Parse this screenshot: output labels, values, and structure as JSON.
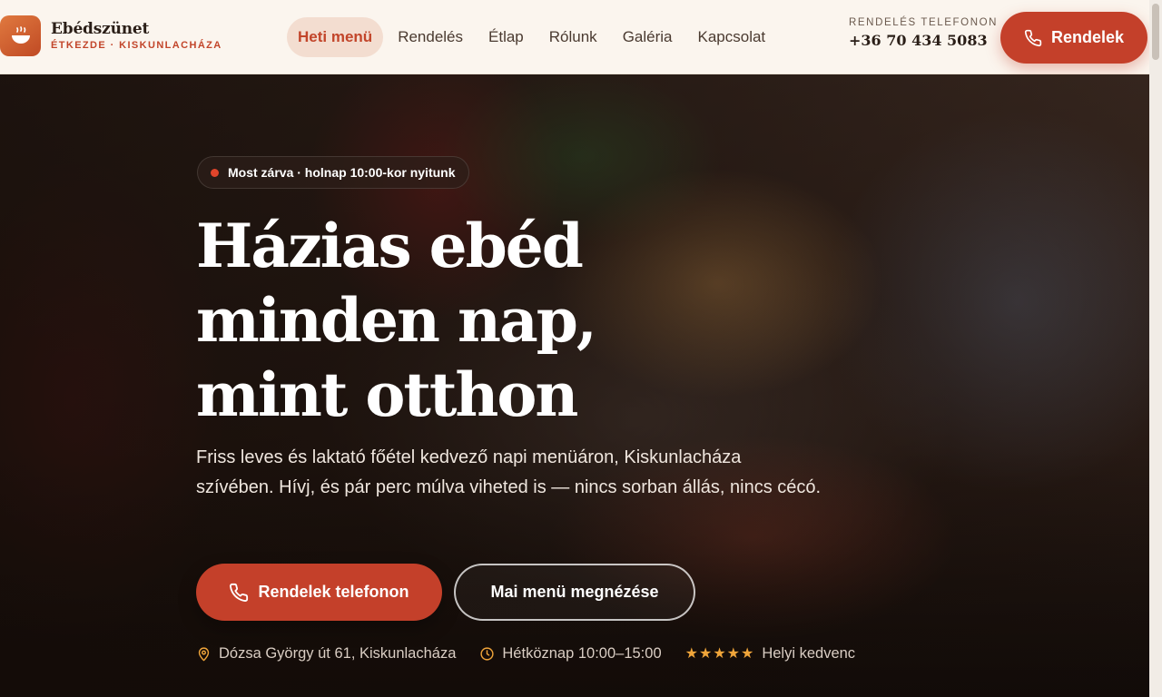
{
  "brand": {
    "name": "Ebédszünet",
    "subtitle": "ÉTKEZDE · KISKUNLACHÁZA",
    "logo_icon": "bowl-icon"
  },
  "nav": {
    "items": [
      {
        "label": "Heti menü",
        "active": true
      },
      {
        "label": "Rendelés",
        "active": false
      },
      {
        "label": "Étlap",
        "active": false
      },
      {
        "label": "Rólunk",
        "active": false
      },
      {
        "label": "Galéria",
        "active": false
      },
      {
        "label": "Kapcsolat",
        "active": false
      }
    ]
  },
  "phone": {
    "label": "RENDELÉS TELEFONON",
    "number": "+36 70 434 5083"
  },
  "header_cta": {
    "label": "Rendelek",
    "icon": "phone-icon"
  },
  "hero": {
    "status": "Most zárva · holnap 10:00-kor nyitunk",
    "title_lines": [
      "Házias ebéd",
      "minden nap,",
      "mint otthon"
    ],
    "description": "Friss leves és laktató főétel kedvező napi menüáron, Kiskunlacháza szívében. Hívj, és pár perc múlva viheted is — nincs sorban állás, nincs cécó.",
    "primary_button": "Rendelek telefonon",
    "secondary_button": "Mai menü megnézése",
    "meta": {
      "address": "Dózsa György út 61, Kiskunlacháza",
      "hours": "Hétköznap 10:00–15:00",
      "stars": "★★★★★",
      "rating_text": "Helyi kedvenc"
    }
  },
  "colors": {
    "accent": "#c4402a",
    "header_bg": "#fbf5ee",
    "active_nav_bg": "#f3ddd0",
    "star": "#f0a53a"
  }
}
